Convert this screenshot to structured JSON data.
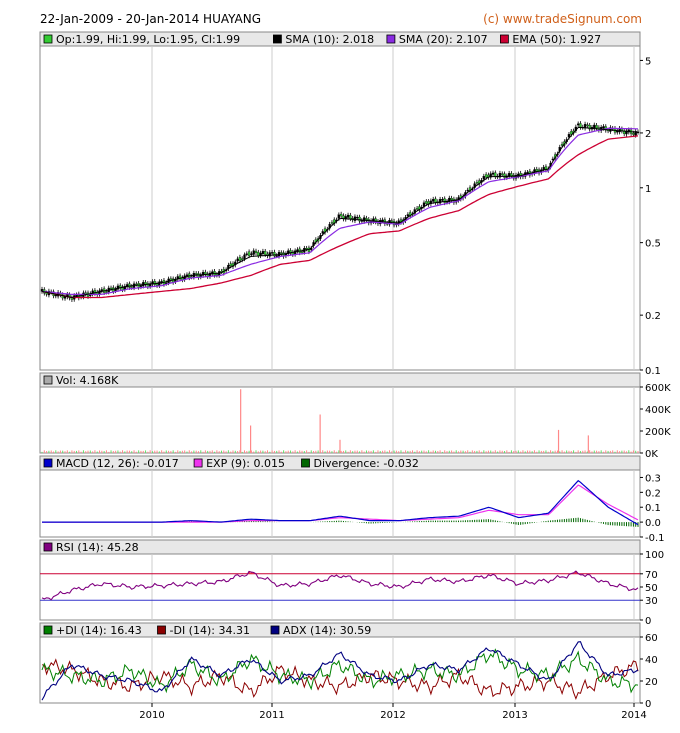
{
  "header": {
    "title": "22-Jan-2009 - 20-Jan-2014 HUAYANG",
    "source": "(c) www.tradeSignum.com"
  },
  "legends": {
    "price": [
      {
        "label": "Op:1.99, Hi:1.99, Lo:1.95, Cl:1.99",
        "color": "#33cc33"
      },
      {
        "label": "SMA (10): 2.018",
        "color": "#000000"
      },
      {
        "label": "SMA (20): 2.107",
        "color": "#8a2be2"
      },
      {
        "label": "EMA (50): 1.927",
        "color": "#cc0033"
      }
    ],
    "volume": [
      {
        "label": "Vol: 4.168K",
        "color": "#aaaaaa"
      }
    ],
    "macd": [
      {
        "label": "MACD (12, 26): -0.017",
        "color": "#0000cc"
      },
      {
        "label": "EXP (9): 0.015",
        "color": "#ee33ee"
      },
      {
        "label": "Divergence: -0.032",
        "color": "#006600"
      }
    ],
    "rsi": [
      {
        "label": "RSI (14): 45.28",
        "color": "#800080"
      }
    ],
    "dmi": [
      {
        "label": "+DI (14): 16.43",
        "color": "#008000"
      },
      {
        "label": "-DI (14): 34.31",
        "color": "#8b0000"
      },
      {
        "label": "ADX (14): 30.59",
        "color": "#000080"
      }
    ]
  },
  "colors": {
    "up": "#33cc33",
    "down": "#000000",
    "sma10": "#000000",
    "sma20": "#8a2be2",
    "ema50": "#cc0033",
    "volume": "#ff8888",
    "volume_up": "#66dd66",
    "macd": "#0000cc",
    "exp": "#ee33ee",
    "divergence": "#006600",
    "rsi": "#800080",
    "rsi_fill": "#ee3344",
    "pdi": "#008000",
    "mdi": "#8b0000",
    "adx": "#000080",
    "grid": "#cccccc"
  },
  "chart_data": [
    {
      "type": "candlestick",
      "name": "price",
      "scale": "log",
      "ylim": [
        0.1,
        6
      ],
      "yticks": [
        {
          "v": 5,
          "label": "5"
        },
        {
          "v": 2,
          "label": "2"
        },
        {
          "v": 1,
          "label": "1"
        },
        {
          "v": 0.5,
          "label": "0.5"
        },
        {
          "v": 0.2,
          "label": "0.2"
        },
        {
          "v": 0.1,
          "label": "0.1"
        }
      ],
      "x": [
        "2009-01",
        "2009-04",
        "2009-07",
        "2009-10",
        "2010-01",
        "2010-04",
        "2010-07",
        "2010-10",
        "2011-01",
        "2011-04",
        "2011-07",
        "2011-10",
        "2012-01",
        "2012-04",
        "2012-07",
        "2012-10",
        "2013-01",
        "2013-04",
        "2013-07",
        "2013-10",
        "2014-01"
      ],
      "close": [
        0.27,
        0.25,
        0.27,
        0.29,
        0.3,
        0.33,
        0.34,
        0.44,
        0.43,
        0.46,
        0.7,
        0.66,
        0.64,
        0.84,
        0.86,
        1.18,
        1.16,
        1.28,
        2.2,
        2.1,
        1.99
      ],
      "sma10": [
        0.27,
        0.25,
        0.27,
        0.29,
        0.3,
        0.33,
        0.34,
        0.42,
        0.43,
        0.46,
        0.68,
        0.66,
        0.64,
        0.82,
        0.86,
        1.15,
        1.16,
        1.27,
        2.15,
        2.08,
        2.018
      ],
      "sma20": [
        0.27,
        0.26,
        0.26,
        0.28,
        0.29,
        0.32,
        0.33,
        0.38,
        0.42,
        0.44,
        0.6,
        0.65,
        0.63,
        0.78,
        0.85,
        1.08,
        1.15,
        1.24,
        1.95,
        2.12,
        2.107
      ],
      "ema50": [
        0.27,
        0.25,
        0.25,
        0.26,
        0.27,
        0.28,
        0.3,
        0.33,
        0.38,
        0.4,
        0.48,
        0.56,
        0.58,
        0.68,
        0.75,
        0.92,
        1.02,
        1.12,
        1.52,
        1.85,
        1.927
      ]
    },
    {
      "type": "bar",
      "name": "volume",
      "ylim": [
        0,
        600
      ],
      "yticks": [
        {
          "v": 600,
          "label": "600K"
        },
        {
          "v": 400,
          "label": "400K"
        },
        {
          "v": 200,
          "label": "200K"
        },
        {
          "v": 0,
          "label": "0K"
        }
      ],
      "spikes": [
        {
          "x": "2010-09",
          "v": 580
        },
        {
          "x": "2010-10",
          "v": 250
        },
        {
          "x": "2011-05",
          "v": 350
        },
        {
          "x": "2011-07",
          "v": 120
        },
        {
          "x": "2013-05",
          "v": 210
        },
        {
          "x": "2013-08",
          "v": 160
        }
      ],
      "base_level": 25
    },
    {
      "type": "line",
      "name": "macd",
      "ylim": [
        -0.1,
        0.35
      ],
      "yticks": [
        {
          "v": 0.3,
          "label": "0.3"
        },
        {
          "v": 0.2,
          "label": "0.2"
        },
        {
          "v": 0.1,
          "label": "0.1"
        },
        {
          "v": 0.0,
          "label": "0.0"
        },
        {
          "v": -0.1,
          "label": "-0.1"
        }
      ],
      "macd": [
        0,
        0,
        0,
        0,
        0,
        0.01,
        0,
        0.02,
        0.01,
        0.01,
        0.04,
        0.01,
        0.01,
        0.03,
        0.04,
        0.1,
        0.03,
        0.06,
        0.28,
        0.1,
        -0.017
      ],
      "exp": [
        0,
        0,
        0,
        0,
        0,
        0,
        0,
        0.01,
        0.01,
        0.01,
        0.03,
        0.02,
        0.01,
        0.02,
        0.03,
        0.08,
        0.05,
        0.05,
        0.25,
        0.12,
        0.015
      ]
    },
    {
      "type": "line",
      "name": "rsi",
      "ylim": [
        0,
        100
      ],
      "yticks": [
        {
          "v": 100,
          "label": "100"
        },
        {
          "v": 70,
          "label": "70"
        },
        {
          "v": 50,
          "label": "50"
        },
        {
          "v": 30,
          "label": "30"
        },
        {
          "v": 0,
          "label": "0"
        }
      ],
      "values": [
        30,
        45,
        55,
        50,
        52,
        55,
        58,
        72,
        52,
        55,
        68,
        55,
        50,
        62,
        58,
        68,
        55,
        60,
        72,
        55,
        45.28
      ]
    },
    {
      "type": "line",
      "name": "dmi",
      "ylim": [
        0,
        60
      ],
      "yticks": [
        {
          "v": 60,
          "label": "60"
        },
        {
          "v": 40,
          "label": "40"
        },
        {
          "v": 20,
          "label": "20"
        },
        {
          "v": 0,
          "label": "0"
        }
      ],
      "pdi": [
        30,
        25,
        20,
        30,
        15,
        35,
        20,
        40,
        25,
        20,
        35,
        20,
        25,
        30,
        25,
        45,
        30,
        25,
        40,
        20,
        16.43
      ],
      "mdi": [
        35,
        30,
        20,
        15,
        25,
        15,
        25,
        10,
        30,
        20,
        15,
        25,
        20,
        15,
        25,
        10,
        15,
        20,
        10,
        25,
        34.31
      ],
      "adx": [
        5,
        35,
        25,
        20,
        10,
        40,
        25,
        40,
        20,
        25,
        45,
        25,
        20,
        35,
        30,
        50,
        35,
        20,
        55,
        25,
        30.59
      ]
    }
  ],
  "xaxis": {
    "ticks": [
      "2010",
      "2011",
      "2012",
      "2013",
      "2014"
    ]
  }
}
